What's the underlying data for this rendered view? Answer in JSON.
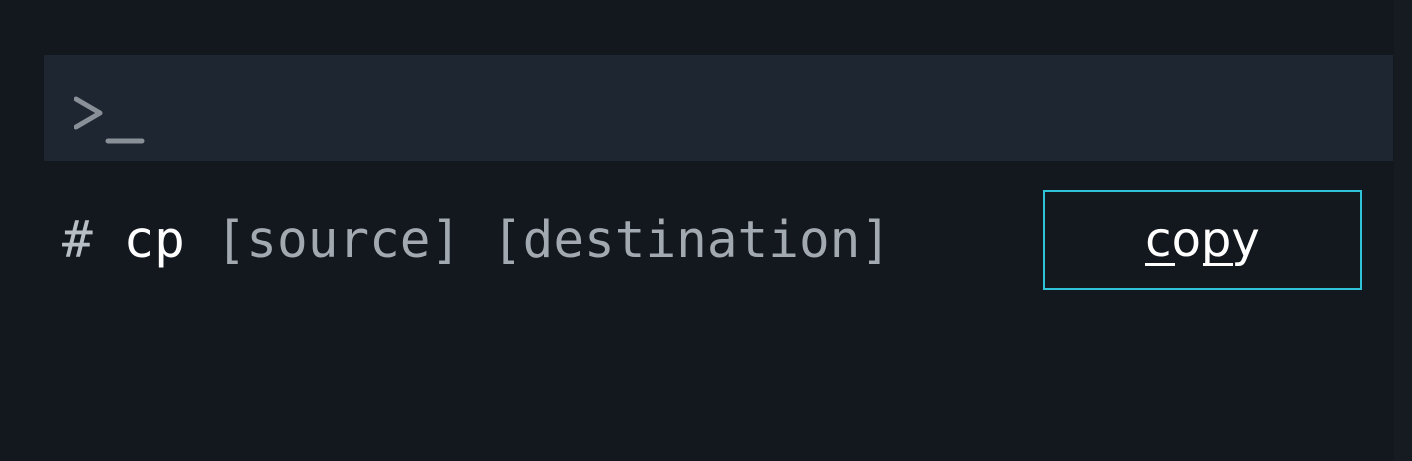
{
  "colors": {
    "background": "#13171e",
    "prompt_bar": "#1e2631",
    "accent_border": "#2fc3d8",
    "text_primary": "#ffffff",
    "text_secondary": "#a3a9b1"
  },
  "prompt": {
    "icon": "terminal-prompt-icon"
  },
  "command": {
    "hash": "#",
    "name": "cp",
    "args": "[source] [destination]"
  },
  "copy_button": {
    "label": "copy"
  }
}
